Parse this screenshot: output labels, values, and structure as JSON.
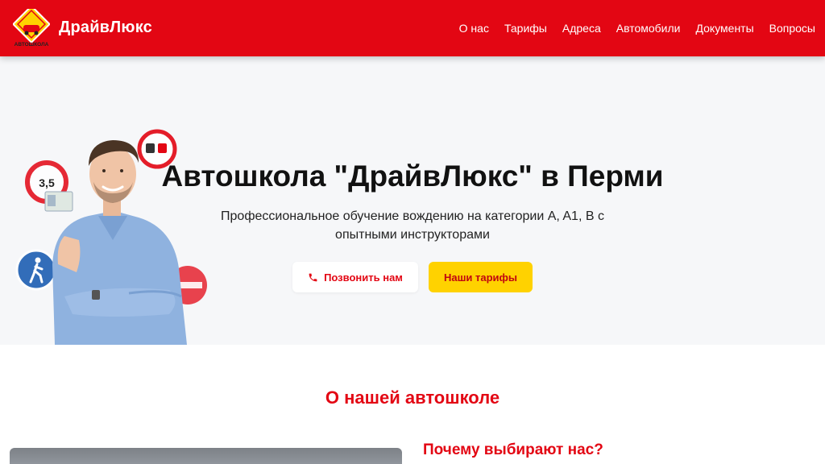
{
  "header": {
    "brand": "ДрайвЛюкс",
    "logo_text": "АВТОШКОЛА",
    "nav": [
      "О нас",
      "Тарифы",
      "Адреса",
      "Автомобили",
      "Документы",
      "Вопросы"
    ]
  },
  "hero": {
    "title": "Автошкола \"ДрайвЛюкс\" в Перми",
    "subtitle": "Профессиональное обучение вождению на категории A, A1, B с опытными инструкторами",
    "call_button": "Позвонить нам",
    "tariffs_button": "Наши тарифы",
    "sign_weight": "3,5"
  },
  "about": {
    "title": "О нашей автошколе",
    "why_title": "Почему выбирают нас?"
  },
  "colors": {
    "brand_red": "#e30613",
    "accent_yellow": "#ffd200"
  }
}
